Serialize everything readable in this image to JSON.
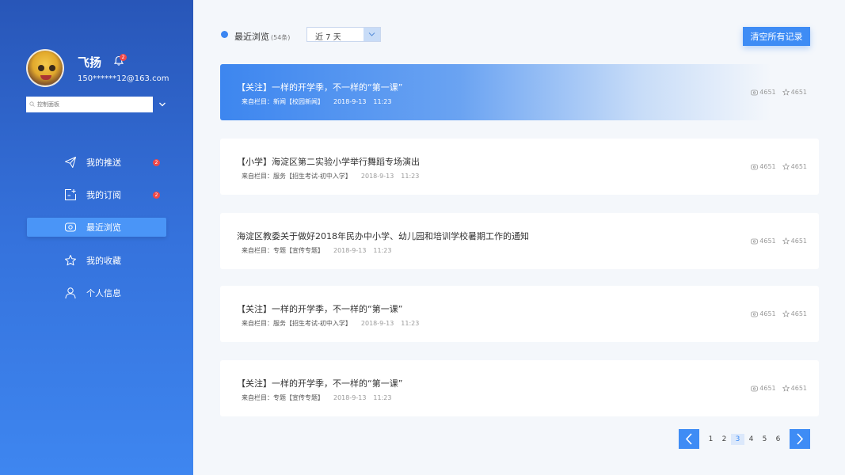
{
  "user": {
    "name": "飞扬",
    "email": "150******12@163.com",
    "notification_count": "2"
  },
  "panel_input": {
    "placeholder": "控制面板"
  },
  "nav": {
    "items": [
      {
        "label": "我的推送",
        "badge": "2"
      },
      {
        "label": "我的订阅",
        "badge": "2"
      },
      {
        "label": "最近浏览",
        "badge": ""
      },
      {
        "label": "我的收藏",
        "badge": ""
      },
      {
        "label": "个人信息",
        "badge": ""
      }
    ]
  },
  "header": {
    "title": "最近浏览",
    "count": "(54条)",
    "range_value": "近 7 天",
    "clear_button": "清空所有记录"
  },
  "records": [
    {
      "title": "【关注】一样的开学季，不一样的“第一课”",
      "source": "来自栏目：新闻【校园新闻】",
      "date": "2018-9-13",
      "time": "11:23",
      "views": "4651",
      "stars": "4651"
    },
    {
      "title": "【小学】海淀区第二实验小学举行舞蹈专场演出",
      "source": "来自栏目：服务【招生考试-初中入学】",
      "date": "2018-9-13",
      "time": "11:23",
      "views": "4651",
      "stars": "4651"
    },
    {
      "title": "海淀区教委关于做好2018年民办中小学、幼儿园和培训学校暑期工作的通知",
      "source": "来自栏目：专题【宣传专题】",
      "date": "2018-9-13",
      "time": "11:23",
      "views": "4651",
      "stars": "4651"
    },
    {
      "title": "【关注】一样的开学季，不一样的“第一课”",
      "source": "来自栏目：服务【招生考试-初中入学】",
      "date": "2018-9-13",
      "time": "11:23",
      "views": "4651",
      "stars": "4651"
    },
    {
      "title": "【关注】一样的开学季，不一样的“第一课”",
      "source": "来自栏目：专题【宣传专题】",
      "date": "2018-9-13",
      "time": "11:23",
      "views": "4651",
      "stars": "4651"
    }
  ],
  "pagination": {
    "pages": [
      "1",
      "2",
      "3",
      "4",
      "5",
      "6"
    ],
    "current": "3"
  },
  "colors": {
    "accent": "#3e8cf5",
    "sidebar_top": "#2856b8",
    "sidebar_bottom": "#3e86f0",
    "badge": "#f04848"
  }
}
